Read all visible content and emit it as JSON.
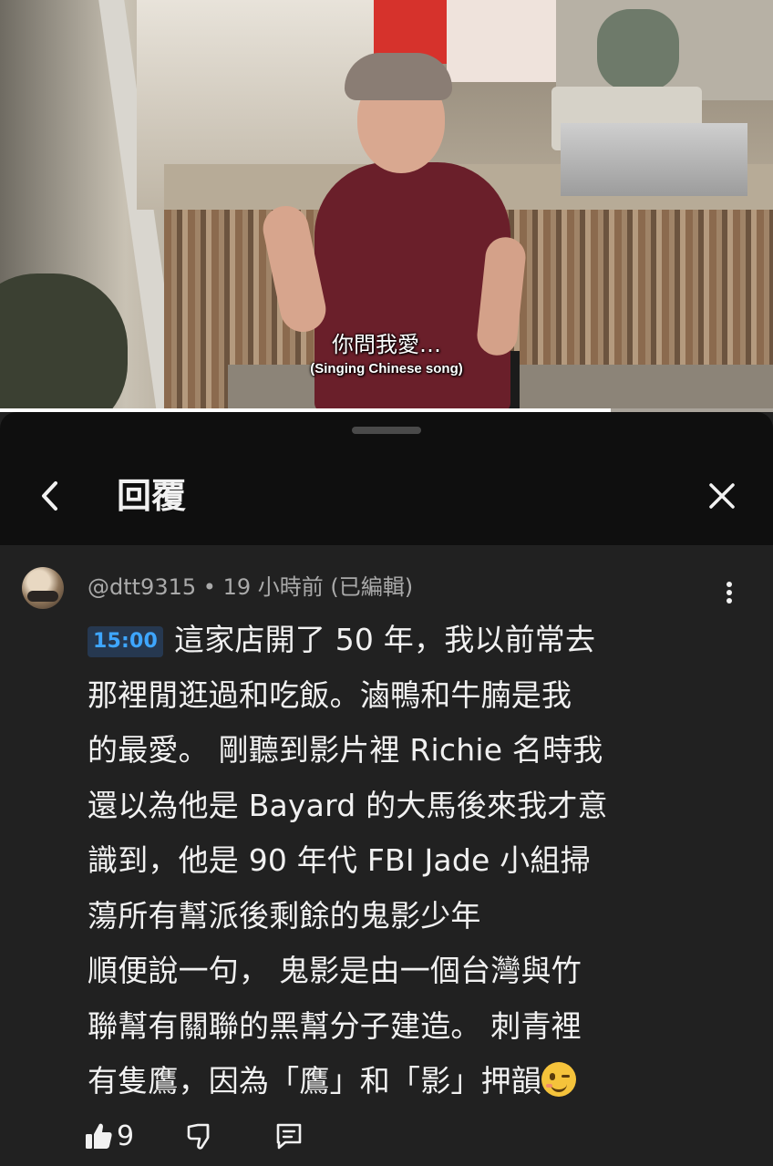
{
  "video": {
    "subtitle_zh": "你問我愛…",
    "subtitle_en": "(Singing Chinese song)",
    "progress_percent": 79
  },
  "panel": {
    "title": "回覆",
    "back_icon": "chevron-left-icon",
    "close_icon": "close-icon"
  },
  "comment": {
    "author": "@dtt9315",
    "separator": "•",
    "time": "19 小時前",
    "edited": "(已編輯)",
    "timestamp": "15:00",
    "lines": [
      "這家店開了 50 年，我以前常去",
      "那裡閒逛過和吃飯。滷鴨和牛腩是我",
      "的最愛。  剛聽到影片裡 Richie 名時我",
      "還以為他是 Bayard 的大馬後來我才意",
      "識到，他是 90 年代 FBI Jade 小組掃",
      "蕩所有幫派後剩餘的鬼影少年",
      "順便說一句，  鬼影是由一個台灣與竹",
      "聯幫有關聯的黑幫分子建造。  刺青裡",
      "有隻鷹，因為「鷹」和「影」押韻"
    ],
    "emoji": "winking-face",
    "likes": "9",
    "more_icon": "more-vertical-icon"
  }
}
